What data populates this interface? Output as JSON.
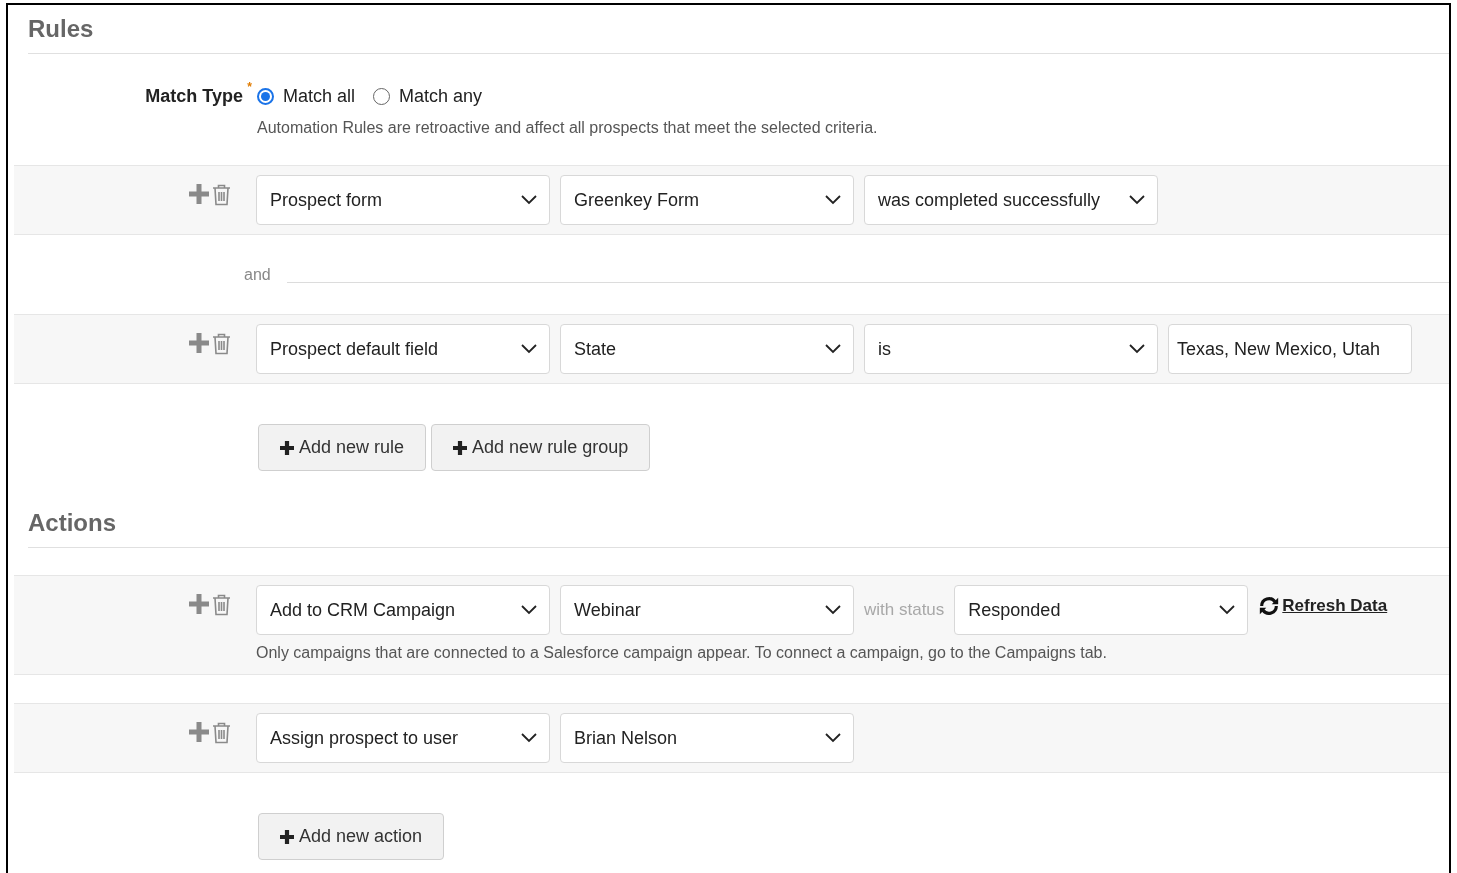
{
  "rules": {
    "title": "Rules",
    "match_type": {
      "label": "Match Type",
      "required_mark": "*",
      "options": [
        {
          "label": "Match all",
          "selected": true
        },
        {
          "label": "Match any",
          "selected": false
        }
      ],
      "help": "Automation Rules are retroactive and affect all prospects that meet the selected criteria."
    },
    "rows": [
      {
        "kind": "condition",
        "fields": [
          {
            "kind": "select",
            "value": "Prospect form"
          },
          {
            "kind": "select",
            "value": "Greenkey Form"
          },
          {
            "kind": "select",
            "value": "was completed successfully"
          }
        ]
      },
      {
        "kind": "separator",
        "label": "and"
      },
      {
        "kind": "condition",
        "fields": [
          {
            "kind": "select",
            "value": "Prospect default field"
          },
          {
            "kind": "select",
            "value": "State"
          },
          {
            "kind": "select",
            "value": "is"
          },
          {
            "kind": "text",
            "value": "Texas, New Mexico, Utah"
          }
        ]
      }
    ],
    "buttons": [
      "Add new rule",
      "Add new rule group"
    ]
  },
  "actions": {
    "title": "Actions",
    "rows": [
      {
        "kind": "condition",
        "fields": [
          {
            "kind": "select",
            "value": "Add to CRM Campaign"
          },
          {
            "kind": "select",
            "value": "Webinar"
          },
          {
            "kind": "label",
            "value": "with status"
          },
          {
            "kind": "select",
            "value": "Responded"
          }
        ],
        "link": "Refresh Data",
        "help": "Only campaigns that are connected to a Salesforce campaign appear. To connect a campaign, go to the Campaigns tab."
      },
      {
        "kind": "condition",
        "fields": [
          {
            "kind": "select",
            "value": "Assign prospect to user"
          },
          {
            "kind": "select",
            "value": "Brian Nelson"
          }
        ]
      }
    ],
    "buttons": [
      "Add new action"
    ]
  }
}
